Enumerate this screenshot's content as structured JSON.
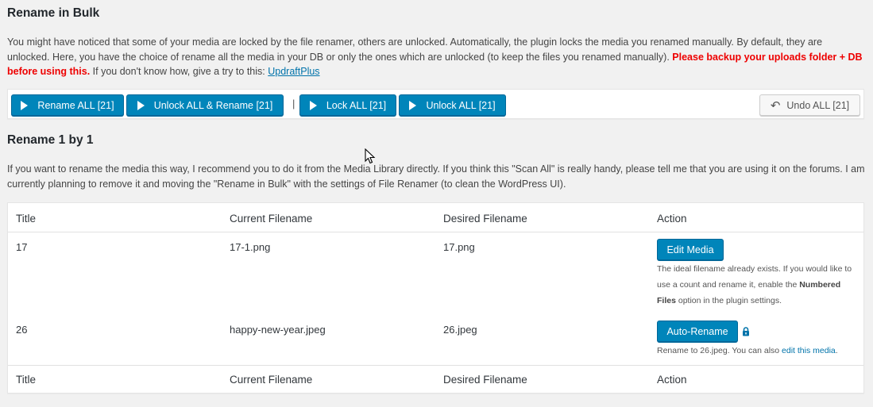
{
  "bulk": {
    "title": "Rename in Bulk",
    "desc_1": "You might have noticed that some of your media are locked by the file renamer, others are unlocked. Automatically, the plugin locks the media you renamed manually. By default, they are unlocked. Here, you have the choice of rename all the media in your DB or only the ones which are unlocked (to keep the files you renamed manually).",
    "warning": "Please backup your uploads folder + DB before using this.",
    "desc_2": "If you don't know how, give a try to this:",
    "link": "UpdraftPlus",
    "buttons": {
      "rename_all": "Rename ALL [21]",
      "unlock_rename": "Unlock ALL & Rename [21]",
      "separator": "|",
      "lock_all": "Lock ALL [21]",
      "unlock_all": "Unlock ALL [21]",
      "undo_all": "Undo ALL [21]"
    }
  },
  "one": {
    "title": "Rename 1 by 1",
    "desc": "If you want to rename the media this way, I recommend you to do it from the Media Library directly. If you think this \"Scan All\" is really handy, please tell me that you are using it on the forums. I am currently planning to remove it and moving the \"Rename in Bulk\" with the settings of File Renamer (to clean the WordPress UI)."
  },
  "table": {
    "columns": [
      "Title",
      "Current Filename",
      "Desired Filename",
      "Action"
    ],
    "rows": [
      {
        "title": "17",
        "current": "17-1.png",
        "desired": "17.png",
        "button": "Edit Media",
        "note_1": "The ideal filename already exists. If you would like to use a count and rename it, enable the",
        "note_bold": "Numbered Files",
        "note_2": "option in the plugin settings."
      },
      {
        "title": "26",
        "current": "happy-new-year.jpeg",
        "desired": "26.jpeg",
        "button": "Auto-Rename",
        "note_1": "Rename to 26.jpeg. You can also",
        "note_link": "edit this media",
        "note_2": "."
      }
    ]
  },
  "colors": {
    "primary": "#0085ba",
    "link": "#0073aa",
    "warning": "#ee0000"
  },
  "icons": [
    "play-icon",
    "undo-icon",
    "lock-icon",
    "mouse-cursor-icon"
  ]
}
